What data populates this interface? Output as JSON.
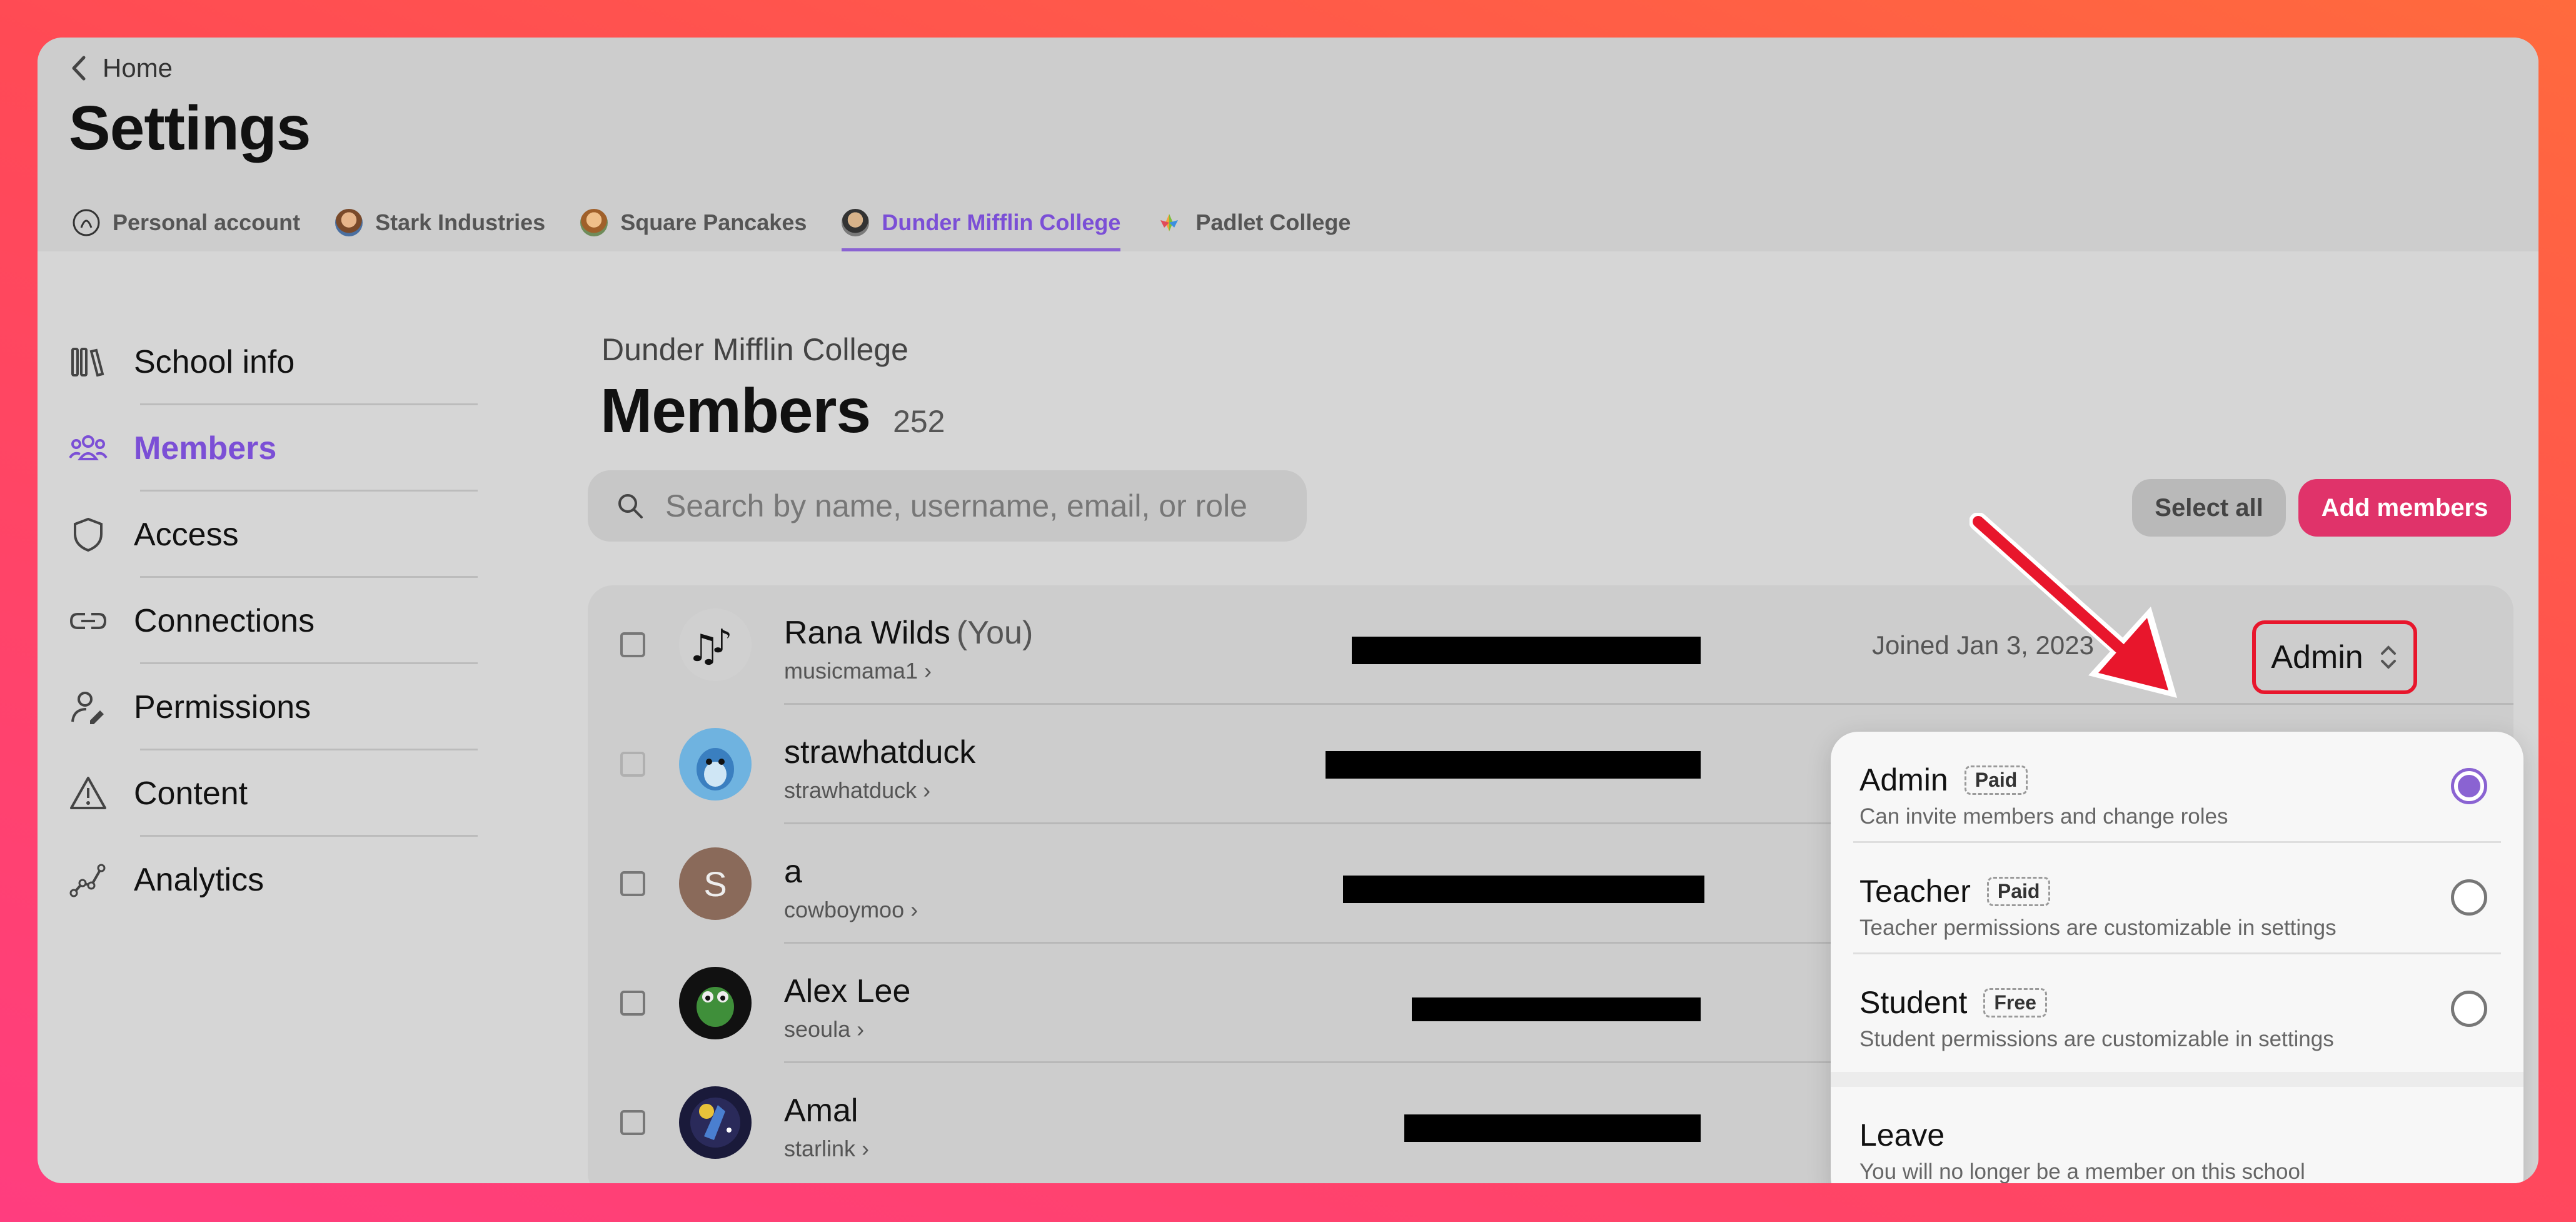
{
  "nav": {
    "back_label": "Home",
    "page_title": "Settings"
  },
  "tabs": [
    {
      "label": "Personal account",
      "icon": "personal-avatar-icon"
    },
    {
      "label": "Stark Industries",
      "icon": "org-avatar-icon"
    },
    {
      "label": "Square Pancakes",
      "icon": "org-avatar-icon"
    },
    {
      "label": "Dunder Mifflin College",
      "icon": "org-avatar-icon",
      "active": true
    },
    {
      "label": "Padlet College",
      "icon": "padlet-logo-icon"
    }
  ],
  "sidebar": {
    "items": [
      {
        "label": "School info",
        "icon": "books-icon"
      },
      {
        "label": "Members",
        "icon": "people-icon",
        "active": true
      },
      {
        "label": "Access",
        "icon": "shield-icon"
      },
      {
        "label": "Connections",
        "icon": "link-icon"
      },
      {
        "label": "Permissions",
        "icon": "user-edit-icon"
      },
      {
        "label": "Content",
        "icon": "warning-icon"
      },
      {
        "label": "Analytics",
        "icon": "analytics-icon"
      }
    ]
  },
  "main": {
    "org_name": "Dunder Mifflin College",
    "heading": "Members",
    "count": "252",
    "search_placeholder": "Search by name, username, email, or role",
    "select_all_label": "Select all",
    "add_members_label": "Add members"
  },
  "members": [
    {
      "name": "Rana Wilds",
      "you_label": "(You)",
      "username": "musicmama1 ›",
      "joined": "Joined Jan 3, 2023",
      "role": "Admin",
      "avatar": "music-notes-icon"
    },
    {
      "name": "strawhatduck",
      "username": "strawhatduck ›",
      "avatar": "cartoon-avatar-icon"
    },
    {
      "name": "a",
      "username": "cowboymoo ›",
      "avatar_letter": "S",
      "avatar": "letter-avatar-icon"
    },
    {
      "name": "Alex Lee",
      "username": "seoula ›",
      "avatar": "frog-avatar-icon"
    },
    {
      "name": "Amal",
      "username": "starlink ›",
      "avatar": "space-avatar-icon"
    }
  ],
  "role_menu": {
    "options": [
      {
        "name": "Admin",
        "badge": "Paid",
        "desc": "Can invite members and change roles",
        "selected": true
      },
      {
        "name": "Teacher",
        "badge": "Paid",
        "desc": "Teacher permissions are customizable in settings",
        "selected": false
      },
      {
        "name": "Student",
        "badge": "Free",
        "desc": "Student permissions are customizable in settings",
        "selected": false
      }
    ],
    "leave": {
      "name": "Leave",
      "desc": "You will no longer be a member on this school"
    }
  },
  "colors": {
    "accent": "#8a63d2",
    "add_button": "#e0336a",
    "annotation_red": "#e8162c"
  }
}
